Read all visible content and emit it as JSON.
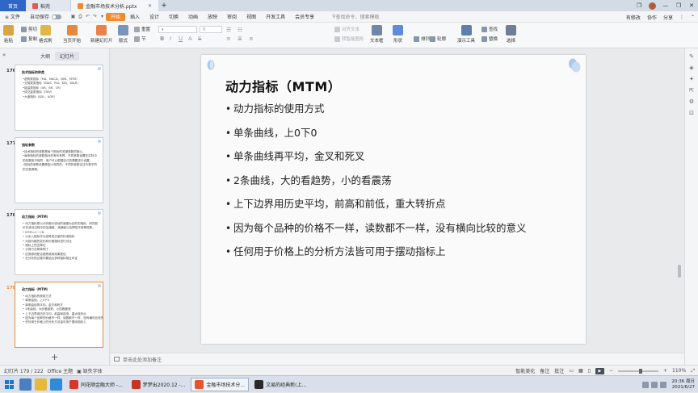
{
  "tabs": [
    {
      "label": "首页",
      "kind": "home"
    },
    {
      "label": "稻壳",
      "kind": "normal",
      "icon_color": "#e45b4b"
    },
    {
      "label": "金融市场技术分析.pptx",
      "kind": "active",
      "icon_color": "#f08a2a"
    }
  ],
  "new_tab_label": "+",
  "window_controls": [
    "❐",
    "—",
    "❐",
    "✕"
  ],
  "menu": {
    "file": "≡ 文件",
    "autosave": "自动保存",
    "items": [
      "开始",
      "插入",
      "设计",
      "切换",
      "动画",
      "放映",
      "审阅",
      "视图",
      "开发工具",
      "会员专享"
    ],
    "search_placeholder": "查找命令、搜索模板",
    "right": [
      "有修改",
      "协作",
      "分享"
    ]
  },
  "ribbon": {
    "paste": "粘贴",
    "cut": "剪切",
    "copy": "复制",
    "format_painter": "格式刷",
    "start_from_current": "当页开始",
    "new_slide": "新建幻灯片",
    "layout": "版式",
    "section": "节",
    "reset": "重置",
    "font_size_value": "0",
    "text_box": "文本框",
    "shape": "形状",
    "arrange": "排列",
    "outline": "轮廓",
    "presentation_tools": "演示工具",
    "find": "查找",
    "replace": "替换",
    "select": "选择",
    "align_text": "对齐文本",
    "convert_smartart": "转智能图形"
  },
  "panel": {
    "tabs": [
      "大纲",
      "幻灯片"
    ],
    "active_tab": "幻灯片",
    "add_label": "+"
  },
  "thumbnails": [
    {
      "number": "176",
      "title": "技术指标的种类",
      "lines": [
        "•趋势类指标（MA、MACD、DMI、MTM）",
        "•交易类类指标（BIAS、RSI、KDJ、W&R）",
        "•能量类指标（AR、BR、CR）",
        "•成交量类指标（OBV）",
        "•大盘指标（ADL、ADR）"
      ]
    },
    {
      "number": "177",
      "title": "指标参数",
      "lines": [
        "•技术指标的参数是每个指标的关键参数的核心。",
        "•每条指标的参数相对的有利有弊，不同参数设置在实际中的效果各不相同，用户可以根据自己的需要进行设置。",
        "•指标的参数设置是因人而异的，不同的参数往往代表不同的交易周期。"
      ]
    },
    {
      "number": "178",
      "title": "动力指标（MTM）",
      "lines": [
        "• 动力指标是以分析股价波动的速度为目的的指标，研究股价在波动过程中的加速度、减速度以及惯性作用等现象。",
        "• MTM＝C－CN",
        "• 以买入指标作为逆势成交量的标准指标",
        "• 对前价格的变化和价格指标进行对比",
        "• 指标上的支撑位",
        "• 计算方法简单明了",
        "• 应用原则配合趋势使用效果更佳",
        "• 在分析的过程中要结合多种指标相互印证"
      ]
    },
    {
      "number": "179",
      "title": "动力指标（MTM）",
      "lines": [
        "• 动力指标的使用方式",
        "• 单条曲线，上0下0",
        "• 单条曲线再平均，金叉和死叉",
        "• 2条曲线，大的看趋势，小的看震荡",
        "• 上下边界用历史平均，前高和前低，重大转折点",
        "• 因为每个品种的价格不一样，读数都不一样，没有横向比较的意义",
        "• 任何用于价格上的分析方法皆可用于摆动指标上"
      ]
    }
  ],
  "current_thumbnail": "179",
  "slide": {
    "title": "动力指标（MTM）",
    "bullet": "•",
    "bullets": [
      "动力指标的使用方式",
      "单条曲线，上0下0",
      "单条曲线再平均，金叉和死叉",
      "2条曲线，大的看趋势，小的看震荡",
      "上下边界用历史平均，前高和前低，重大转折点",
      "因为每个品种的价格不一样，读数都不一样，没有横向比较的意义",
      "任何用于价格上的分析方法皆可用于摆动指标上"
    ]
  },
  "notes_placeholder": "单击此处添加备注",
  "status": {
    "slide_counter": "幻灯片 179 / 222",
    "theme": "Office 主题",
    "missing_font": "缺失字体",
    "smart_beautify": "智能美化",
    "notes": "备注",
    "comments": "批注",
    "zoom": "110%"
  },
  "taskbar": {
    "tasks": [
      {
        "label": "同花顺金融大师 -...",
        "icon_color": "#d8362b",
        "active": false
      },
      {
        "label": "梦梦出2020.12 -...",
        "icon_color": "#c7341f",
        "active": false
      },
      {
        "label": "金融市场技术分...",
        "icon_color": "#e8542f",
        "active": true
      },
      {
        "label": "文易的经典新(上...",
        "icon_color": "#2a2a2a",
        "active": false
      }
    ],
    "time": "20:36 周日",
    "date": "2021/6/27"
  },
  "colors": {
    "accent_orange": "#f08a2a",
    "home_tab_blue": "#2f66c8"
  }
}
